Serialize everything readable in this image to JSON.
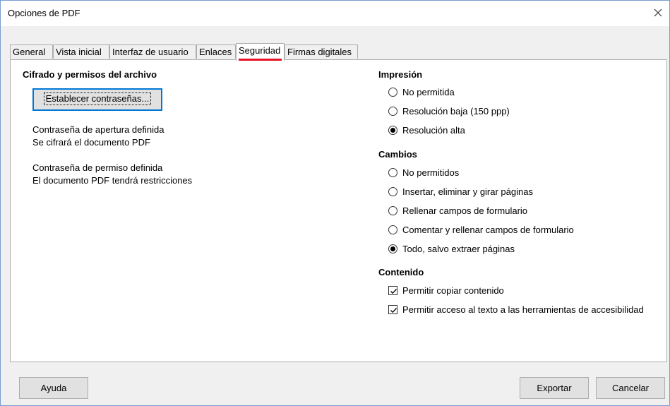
{
  "window": {
    "title": "Opciones de PDF"
  },
  "tabs": [
    {
      "label": "General",
      "active": false
    },
    {
      "label": "Vista inicial",
      "active": false
    },
    {
      "label": "Interfaz de usuario",
      "active": false
    },
    {
      "label": "Enlaces",
      "active": false
    },
    {
      "label": "Seguridad",
      "active": true
    },
    {
      "label": "Firmas digitales",
      "active": false
    }
  ],
  "encryption": {
    "heading": "Cifrado y permisos del archivo",
    "set_passwords_button": "Establecer contraseñas...",
    "status_open_line1": "Contraseña de apertura definida",
    "status_open_line2": "Se cifrará el documento PDF",
    "status_perm_line1": "Contraseña de permiso definida",
    "status_perm_line2": "El documento PDF tendrá restricciones"
  },
  "printing": {
    "heading": "Impresión",
    "options": [
      {
        "label": "No permitida",
        "checked": false
      },
      {
        "label": "Resolución baja (150 ppp)",
        "checked": false
      },
      {
        "label": "Resolución alta",
        "checked": true
      }
    ]
  },
  "changes": {
    "heading": "Cambios",
    "options": [
      {
        "label": "No permitidos",
        "checked": false
      },
      {
        "label": "Insertar, eliminar y girar páginas",
        "checked": false
      },
      {
        "label": "Rellenar campos de formulario",
        "checked": false
      },
      {
        "label": "Comentar y rellenar campos de formulario",
        "checked": false
      },
      {
        "label": "Todo, salvo extraer páginas",
        "checked": true
      }
    ]
  },
  "content": {
    "heading": "Contenido",
    "options": [
      {
        "label": "Permitir copiar contenido",
        "checked": true
      },
      {
        "label": "Permitir acceso al texto a las herramientas de accesibilidad",
        "checked": true
      }
    ]
  },
  "footer": {
    "help": "Ayuda",
    "export": "Exportar",
    "cancel": "Cancelar"
  },
  "colors": {
    "accent": "#0078d7",
    "active_tab_marker": "#e81123",
    "border": "#7a9ccf"
  }
}
